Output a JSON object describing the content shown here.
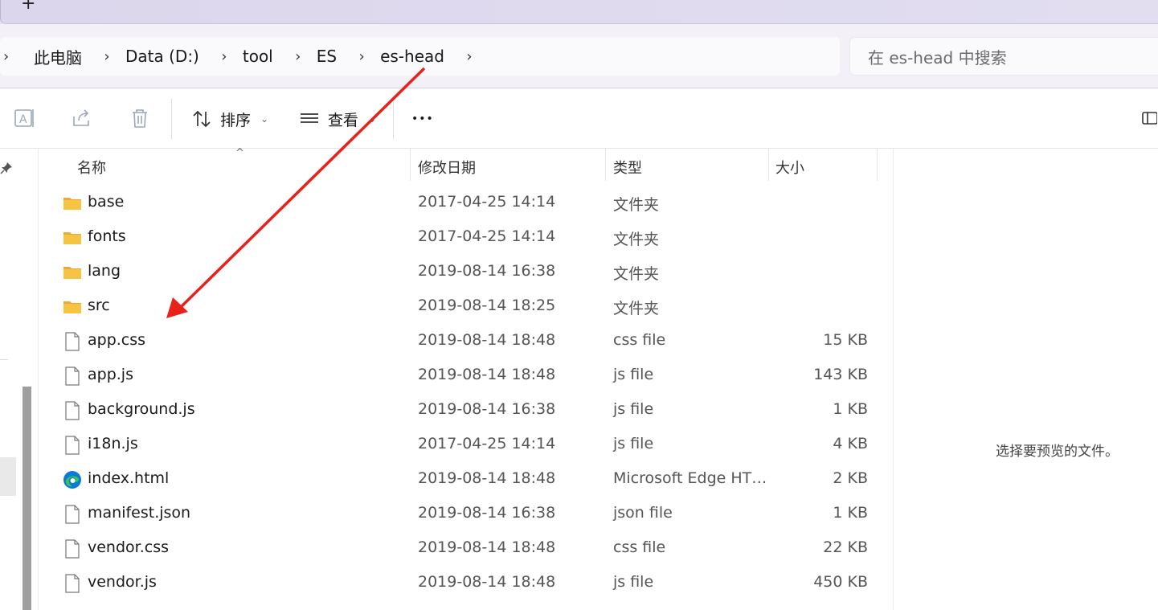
{
  "tabstrip": {
    "new_tab": "+"
  },
  "breadcrumb": [
    "此电脑",
    "Data (D:)",
    "tool",
    "ES",
    "es-head"
  ],
  "search": {
    "placeholder": "在 es-head 中搜索"
  },
  "toolbar": {
    "sort_label": "排序",
    "view_label": "查看",
    "more_label": "•••"
  },
  "columns": {
    "name": "名称",
    "modified": "修改日期",
    "type": "类型",
    "size": "大小"
  },
  "files": [
    {
      "name": "base",
      "modified": "2017-04-25 14:14",
      "type": "文件夹",
      "size": "",
      "icon": "folder-icon"
    },
    {
      "name": "fonts",
      "modified": "2017-04-25 14:14",
      "type": "文件夹",
      "size": "",
      "icon": "folder-icon"
    },
    {
      "name": "lang",
      "modified": "2019-08-14 16:38",
      "type": "文件夹",
      "size": "",
      "icon": "folder-icon"
    },
    {
      "name": "src",
      "modified": "2019-08-14 18:25",
      "type": "文件夹",
      "size": "",
      "icon": "folder-icon"
    },
    {
      "name": "app.css",
      "modified": "2019-08-14 18:48",
      "type": "css file",
      "size": "15 KB",
      "icon": "file-icon"
    },
    {
      "name": "app.js",
      "modified": "2019-08-14 18:48",
      "type": "js file",
      "size": "143 KB",
      "icon": "file-icon"
    },
    {
      "name": "background.js",
      "modified": "2019-08-14 16:38",
      "type": "js file",
      "size": "1 KB",
      "icon": "file-icon"
    },
    {
      "name": "i18n.js",
      "modified": "2017-04-25 14:14",
      "type": "js file",
      "size": "4 KB",
      "icon": "file-icon"
    },
    {
      "name": "index.html",
      "modified": "2019-08-14 18:48",
      "type": "Microsoft Edge HT…",
      "size": "2 KB",
      "icon": "edge-icon"
    },
    {
      "name": "manifest.json",
      "modified": "2019-08-14 16:38",
      "type": "json file",
      "size": "1 KB",
      "icon": "file-icon"
    },
    {
      "name": "vendor.css",
      "modified": "2019-08-14 18:48",
      "type": "css file",
      "size": "22 KB",
      "icon": "file-icon"
    },
    {
      "name": "vendor.js",
      "modified": "2019-08-14 18:48",
      "type": "js file",
      "size": "450 KB",
      "icon": "file-icon"
    }
  ],
  "preview": {
    "empty_text": "选择要预览的文件。"
  },
  "colors": {
    "folder": "#f6c343",
    "arrow": "#e8211b",
    "accent": "#0067c0"
  }
}
